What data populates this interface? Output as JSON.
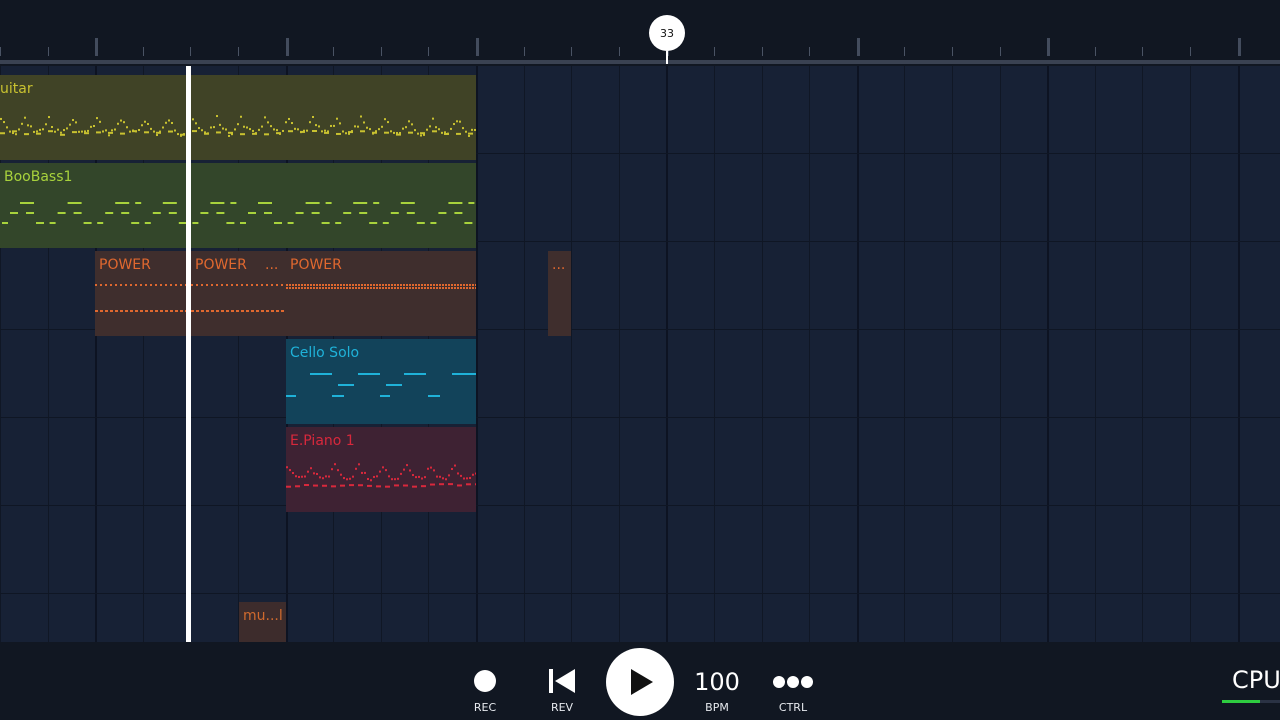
{
  "timeline": {
    "playhead_bar": "33"
  },
  "tracks": [
    {
      "name": "uitar",
      "color": "#c9c230",
      "bg": "#404326"
    },
    {
      "name": "BooBass1",
      "color": "#a8d23c",
      "bg": "#33462a"
    },
    {
      "name": "POWER",
      "color": "#e0682f",
      "bg": "#3f2e2d"
    },
    {
      "name": "Cello Solo",
      "color": "#1fb2d9",
      "bg": "#12435a"
    },
    {
      "name": "E.Piano 1",
      "color": "#d8283c",
      "bg": "#3e2233"
    },
    {
      "name": "",
      "color": "",
      "bg": ""
    },
    {
      "name": "mu...l",
      "color": "#d06a2e",
      "bg": "#3d2c2c"
    }
  ],
  "clips": {
    "guitar": "uitar",
    "bass": "BooBass1",
    "power1": "POWER",
    "power2": "POWER",
    "power3": "...",
    "power4": "POWER",
    "power5": "...",
    "cello": "Cello Solo",
    "epiano": "E.Piano 1",
    "music": "mu...l"
  },
  "transport": {
    "rec": "REC",
    "rev": "REV",
    "bpm_value": "100",
    "bpm": "BPM",
    "ctrl": "CTRL",
    "cpu": "CPU"
  },
  "colors": {
    "background": "#162033",
    "toolbar": "#111722",
    "playhead": "#ffffff",
    "cpu_meter": "#2ecc40"
  }
}
